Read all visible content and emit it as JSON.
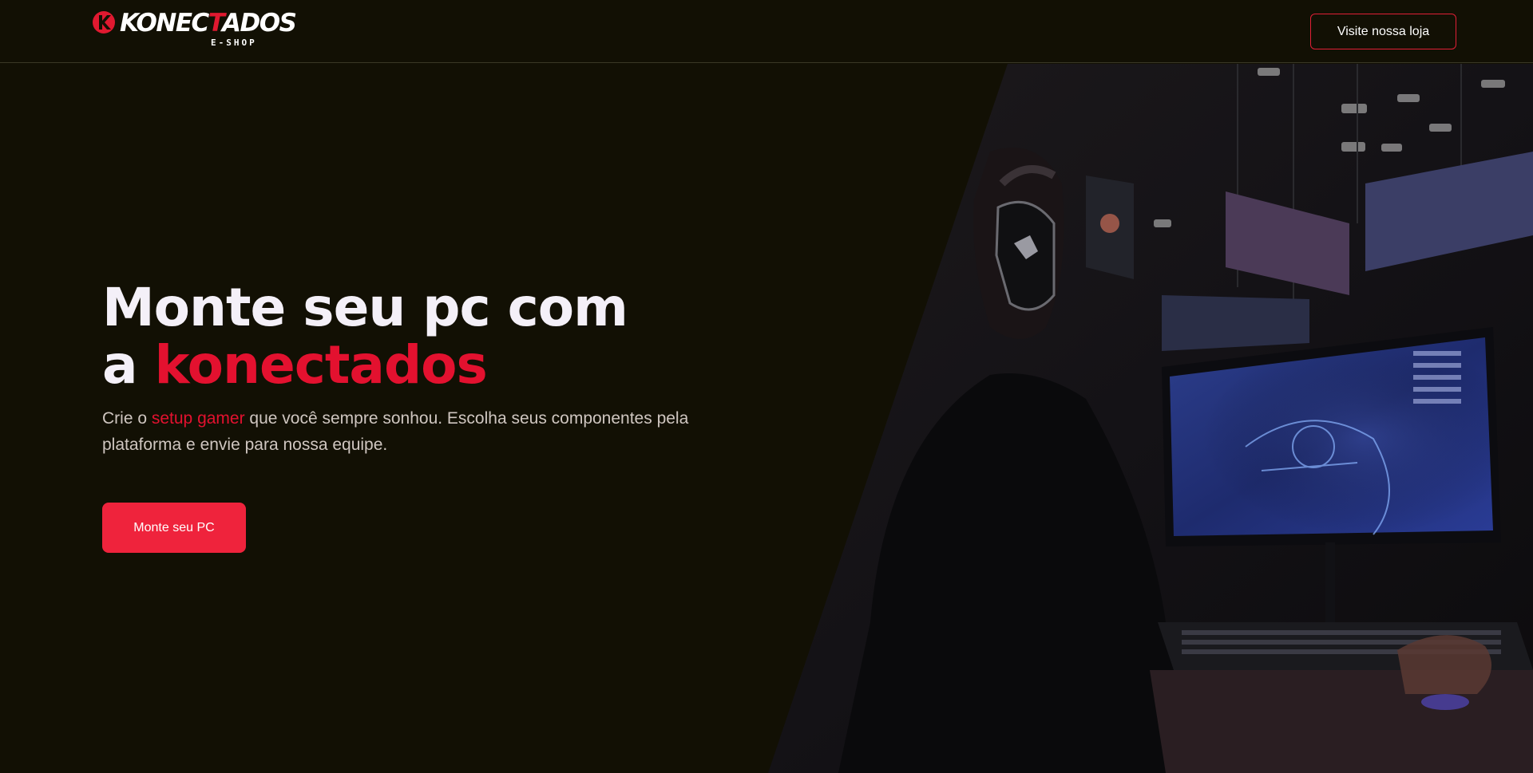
{
  "brand": {
    "name_part1": "KONEC",
    "name_accent": "T",
    "name_part2": "ADOS",
    "subtitle": "E-SHOP",
    "accent_color": "#e01930"
  },
  "header": {
    "store_button_label": "Visite nossa loja"
  },
  "hero": {
    "title_line1": "Monte seu pc com",
    "title_line2_prefix": "a ",
    "title_line2_accent": "konectados",
    "desc_prefix": "Crie o ",
    "desc_accent": "setup gamer",
    "desc_suffix": " que você sempre sonhou. Escolha seus componentes pela plataforma e envie para nossa equipe.",
    "cta_label": "Monte seu PC",
    "image_icon": "gamer-at-pc-photo"
  },
  "colors": {
    "background": "#121004",
    "accent": "#e3112f",
    "cta": "#ef233c"
  }
}
